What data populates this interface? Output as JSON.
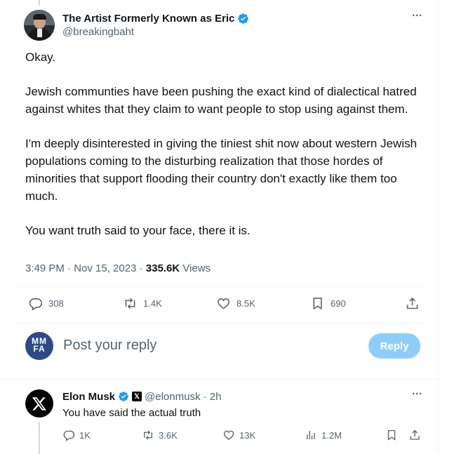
{
  "tweet": {
    "author_name": "The Artist Formerly Known as Eric",
    "author_handle": "@breakingbaht",
    "more": "···",
    "paragraphs": [
      "Okay.",
      "Jewish communties have been pushing the exact kind of dialectical hatred against whites that they claim to want people to stop using against them.",
      "I'm deeply disinterested in giving the tiniest shit now about western Jewish populations coming to the disturbing realization that those hordes of minorities that support flooding their country don't exactly like them too much.",
      "You want truth said to your face, there it is."
    ],
    "time": "3:49 PM · Nov 15, 2023 · ",
    "views_count": "335.6K",
    "views_label": " Views",
    "replies": "308",
    "reposts": "1.4K",
    "likes": "8.5K",
    "bookmarks": "690"
  },
  "composer": {
    "avatar_text": "MM FA",
    "placeholder": "Post your reply",
    "button": "Reply"
  },
  "reply": {
    "author_name": "Elon Musk",
    "affiliation_badge": "𝕏",
    "handle_time": "@elonmusk · 2h",
    "more": "···",
    "text": "You have said the actual truth",
    "replies": "1K",
    "reposts": "3.6K",
    "likes": "13K",
    "views": "1.2M"
  },
  "colors": {
    "text": "#0f1419",
    "secondary": "#536471",
    "verified": "#1d9bf0",
    "reply_button": "#8ecdf8",
    "mmfa_avatar": "#2b4a87"
  },
  "icons": [
    "verified-badge-icon",
    "more-icon",
    "reply-icon",
    "repost-icon",
    "like-icon",
    "bookmark-icon",
    "share-icon",
    "views-icon",
    "x-logo-icon"
  ]
}
